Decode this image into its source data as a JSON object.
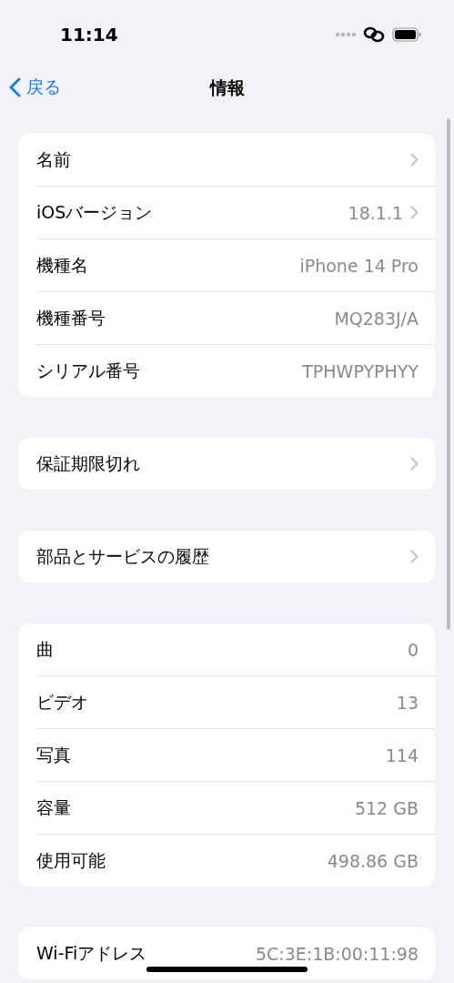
{
  "status_bar": {
    "time": "11:14"
  },
  "nav": {
    "back": "戻る",
    "title": "情報"
  },
  "groups": [
    {
      "rows": [
        {
          "label": "名前",
          "chevron": true
        },
        {
          "label": "iOSバージョン",
          "value": "18.1.1",
          "chevron": true
        },
        {
          "label": "機種名",
          "value": "iPhone 14 Pro"
        },
        {
          "label": "機種番号",
          "value": "MQ283J/A"
        },
        {
          "label": "シリアル番号",
          "value": "TPHWPYPHYY"
        }
      ]
    },
    {
      "rows": [
        {
          "label": "保証期限切れ",
          "chevron": true
        }
      ]
    },
    {
      "rows": [
        {
          "label": "部品とサービスの履歴",
          "chevron": true
        }
      ]
    },
    {
      "rows": [
        {
          "label": "曲",
          "value": "0"
        },
        {
          "label": "ビデオ",
          "value": "13"
        },
        {
          "label": "写真",
          "value": "114"
        },
        {
          "label": "容量",
          "value": "512 GB"
        },
        {
          "label": "使用可能",
          "value": "498.86 GB"
        }
      ]
    },
    {
      "rows": [
        {
          "label": "Wi-Fiアドレス",
          "value": "5C:3E:1B:00:11:98"
        }
      ]
    }
  ]
}
